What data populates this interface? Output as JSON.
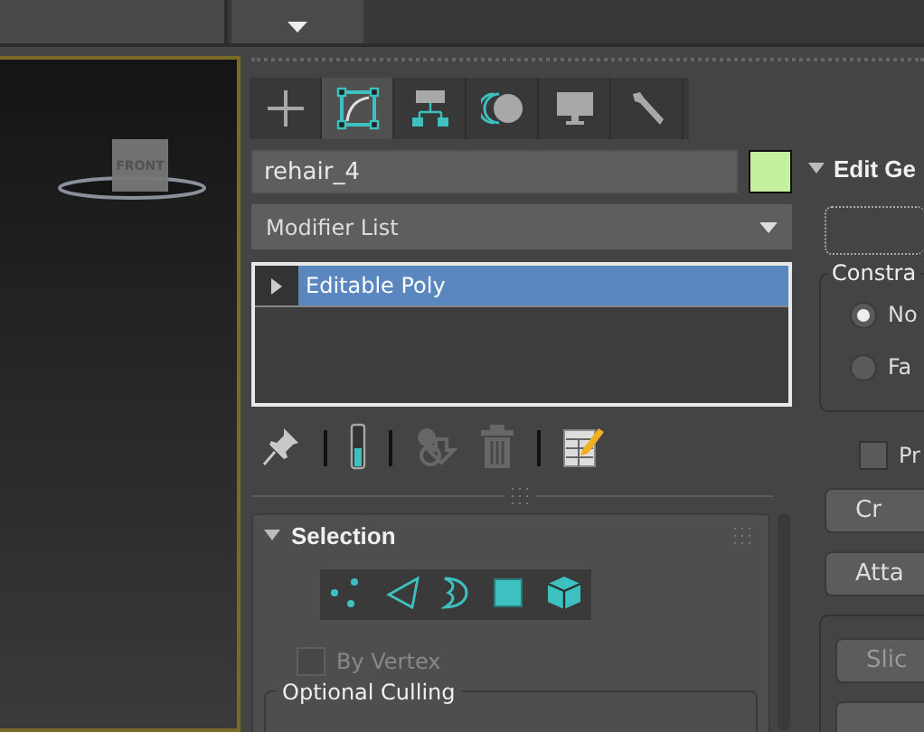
{
  "viewport": {
    "active": true,
    "viewcube_label": "FRONT"
  },
  "command_panel": {
    "tabs": [
      {
        "selected": false
      },
      {
        "selected": true
      },
      {
        "selected": false
      },
      {
        "selected": false
      },
      {
        "selected": false
      },
      {
        "selected": false
      }
    ],
    "object_name": "rehair_4",
    "modifier_list": {
      "label": "Modifier List"
    },
    "modifier_stack": [
      {
        "label": "Editable Poly",
        "selected": true
      }
    ],
    "stack_tools": [
      {
        "disabled": false
      },
      {
        "disabled": false
      },
      {
        "disabled": true
      },
      {
        "disabled": true
      },
      {
        "disabled": false
      }
    ],
    "selection_rollout": {
      "title": "Selection",
      "subobject_modes": [
        {
          "selected": false
        },
        {
          "selected": false
        },
        {
          "selected": false
        },
        {
          "selected": false
        },
        {
          "selected": false
        }
      ],
      "by_vertex": {
        "label": "By Vertex",
        "checked": false,
        "disabled": true
      },
      "group_title": "Optional Culling"
    },
    "edit_geometry": {
      "title": "Edit Ge",
      "constraints": {
        "title": "Constra",
        "options": [
          {
            "label": "No",
            "selected": true
          },
          {
            "label": "Fa",
            "selected": false
          }
        ]
      },
      "checkbox": {
        "label": "Pr",
        "checked": false
      },
      "buttons": [
        "Cr",
        "Atta"
      ],
      "group_buttons": [
        "Slic"
      ]
    }
  }
}
